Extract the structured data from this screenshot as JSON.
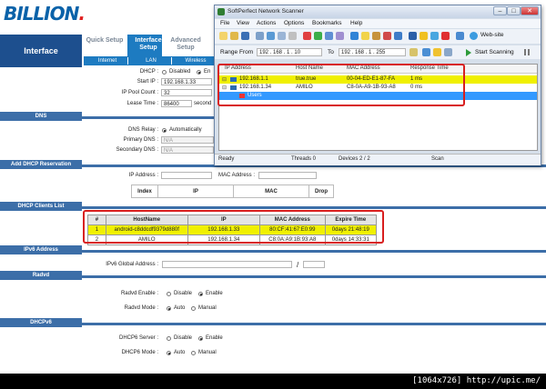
{
  "router": {
    "logo_text": "BILLION",
    "section_title": "Interface",
    "tabs": [
      {
        "label": "Quick Setup",
        "active": false
      },
      {
        "label": "Interface Setup",
        "active": true
      },
      {
        "label": "Advanced Setup",
        "active": false
      }
    ],
    "subtabs": [
      "Internet",
      "LAN",
      "Wireless"
    ],
    "dhcp": {
      "dhcp_label": "DHCP :",
      "dhcp_opt1": "Disabled",
      "dhcp_opt2": "En",
      "start_ip_label": "Start IP :",
      "start_ip": "192.168.1.33",
      "pool_count_label": "IP Pool Count :",
      "pool_count": "32",
      "lease_label": "Lease Time :",
      "lease_time": "86400",
      "lease_unit": "second"
    },
    "dns": {
      "band": "DNS",
      "relay_label": "DNS Relay :",
      "relay_value": "Automatically",
      "primary_label": "Primary DNS :",
      "primary_value": "N/A",
      "secondary_label": "Secondary DNS :",
      "secondary_value": "N/A"
    },
    "reservation": {
      "band": "Add DHCP Reservation",
      "ip_label": "IP Address :",
      "mac_label": "MAC Address :",
      "columns": [
        "Index",
        "IP",
        "MAC",
        "Drop"
      ]
    },
    "clients": {
      "band": "DHCP Clients List",
      "columns": [
        "#",
        "HostName",
        "IP",
        "MAC Address",
        "Expire Time"
      ],
      "rows": [
        {
          "n": "1",
          "host": "android-c8ddcdf9379d880f",
          "ip": "192.168.1.33",
          "mac": "80:CF:41:67:E0:99",
          "expire": "0days 21:48:19"
        },
        {
          "n": "2",
          "host": "AMILO",
          "ip": "192.168.1.34",
          "mac": "C8:0A:A9:1B:93:A8",
          "expire": "0days 14:33:31"
        }
      ]
    },
    "ipv6": {
      "band": "IPv6 Address",
      "global_label": "IPv6 Global Address :",
      "slash": "/"
    },
    "radvd": {
      "band": "Radvd",
      "enable_label": "Radvd Enable :",
      "enable_opts": [
        "Disable",
        "Enable"
      ],
      "mode_label": "Radvd Mode :",
      "mode_opts": [
        "Auto",
        "Manual"
      ]
    },
    "dhcpv6": {
      "band": "DHCPv6",
      "server_label": "DHCP6 Server :",
      "server_opts": [
        "Disable",
        "Enable"
      ],
      "mode_label": "DHCP6 Mode :",
      "mode_opts": [
        "Auto",
        "Manual"
      ]
    }
  },
  "scanner": {
    "title": "SoftPerfect Network Scanner",
    "menu": [
      "File",
      "View",
      "Actions",
      "Options",
      "Bookmarks",
      "Help"
    ],
    "website_label": "Web-site",
    "range_label": "Range From",
    "range_from": "192 . 168 . 1 . 10",
    "range_to_label": "To",
    "range_to": "192 . 168 . 1 . 255",
    "start_label": "Start Scanning",
    "columns": [
      "IP Address",
      "Host Name",
      "MAC Address",
      "Response Time"
    ],
    "rows": [
      {
        "ip": "192.168.1.1",
        "host": "true.true",
        "mac": "00-04-ED-E1-87-FA",
        "time": "1 ms"
      },
      {
        "ip": "192.168.1.34",
        "host": "AMILO",
        "mac": "C8-0A-A9-1B-93-A8",
        "time": "0 ms"
      }
    ],
    "group_label": "Users",
    "status": {
      "ready": "Ready",
      "threads": "Threads  0",
      "devices": "Devices   2 / 2",
      "scan": "Scan"
    }
  },
  "footer": "[1064x726] http://upic.me/",
  "colors": {
    "accent": "#1d7bc1",
    "band": "#3c6ea8",
    "highlight": "#f0f000",
    "red": "#d81e1e"
  }
}
